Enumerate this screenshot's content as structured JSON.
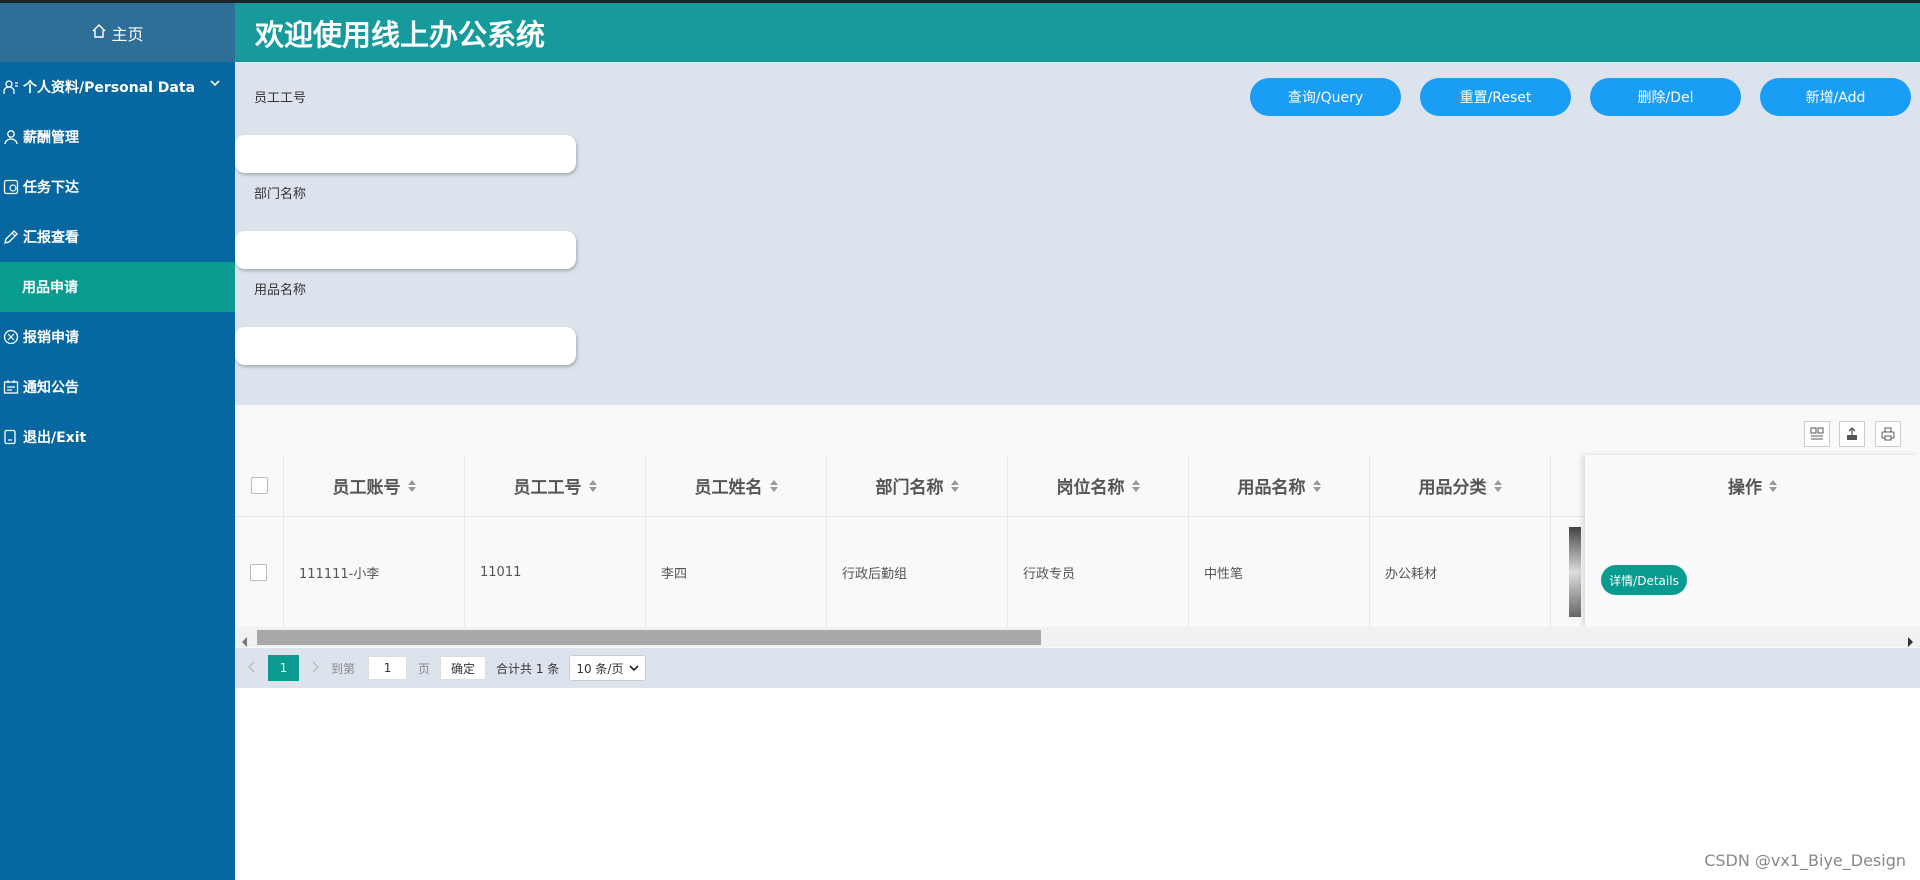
{
  "header": {
    "title": "欢迎使用线上办公系统"
  },
  "sidebar": {
    "home_label": "主页",
    "items": [
      {
        "label": "个人资料/Personal Data",
        "icon": "user-card-icon"
      },
      {
        "label": "薪酬管理",
        "icon": "person-icon"
      },
      {
        "label": "任务下达",
        "icon": "task-icon"
      },
      {
        "label": "汇报查看",
        "icon": "edit-icon"
      },
      {
        "label": "用品申请",
        "icon": "",
        "active": true
      },
      {
        "label": "报销申请",
        "icon": "reimburse-icon"
      },
      {
        "label": "通知公告",
        "icon": "notice-icon"
      },
      {
        "label": "退出/Exit",
        "icon": "exit-icon"
      }
    ]
  },
  "search": {
    "fields": [
      {
        "label": "员工工号",
        "value": ""
      },
      {
        "label": "部门名称",
        "value": ""
      },
      {
        "label": "用品名称",
        "value": ""
      }
    ],
    "buttons": {
      "query": "查询/Query",
      "reset": "重置/Reset",
      "delete": "删除/Del",
      "add": "新增/Add"
    }
  },
  "table": {
    "columns": [
      "员工账号",
      "员工工号",
      "员工姓名",
      "部门名称",
      "岗位名称",
      "用品名称",
      "用品分类"
    ],
    "action_column": "操作",
    "rows": [
      {
        "cells": [
          "111111-小李",
          "11011",
          "李四",
          "行政后勤组",
          "行政专员",
          "中性笔",
          "办公耗材"
        ],
        "details_label": "详情/Details"
      }
    ]
  },
  "pagination": {
    "current_page": "1",
    "goto_label": "到第",
    "page_input": "1",
    "page_unit": "页",
    "confirm_label": "确定",
    "total_text": "合计共 1 条",
    "page_size": "10 条/页"
  },
  "watermark": "CSDN @vx1_Biye_Design",
  "colors": {
    "sidebar": "#0667a1",
    "header": "#169a9c",
    "accent_teal": "#099b8f",
    "button_blue": "#1a9df5"
  }
}
